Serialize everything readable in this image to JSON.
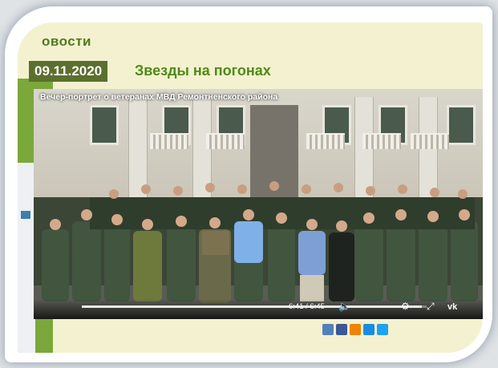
{
  "page": {
    "section_title": "овости",
    "article": {
      "date": "09.11.2020",
      "title": "Звезды на погонах"
    }
  },
  "video": {
    "caption": "Вечер-портрет о ветеранах МВД Ремонтненского района",
    "time": "6:41 / 6:45",
    "progress": 0.985,
    "icons": [
      "volume-icon",
      "settings-icon",
      "fullscreen-icon",
      "vk-logo-icon"
    ]
  },
  "share": {
    "buttons": [
      {
        "name": "vk-share-icon",
        "color": "#5181b8"
      },
      {
        "name": "facebook-share-icon",
        "color": "#3b5998"
      },
      {
        "name": "odnoklassniki-share-icon",
        "color": "#ee8208"
      },
      {
        "name": "mail-share-icon",
        "color": "#168de2"
      },
      {
        "name": "twitter-share-icon",
        "color": "#1da1f2"
      }
    ]
  },
  "colors": {
    "accent_green": "#4f8a16",
    "date_bg": "#5b6f2e",
    "page_bg": "#f4f1d0"
  }
}
